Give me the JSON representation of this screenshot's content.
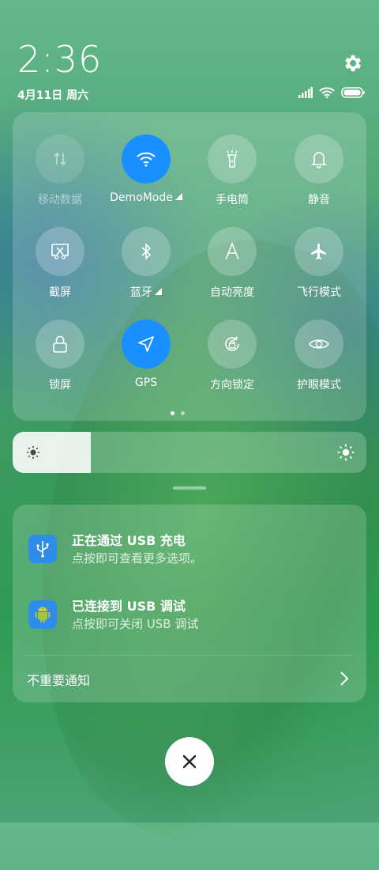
{
  "status_bar": {
    "time": "2:36",
    "date": "4月11日 周六",
    "icons": [
      "signal-icon",
      "wifi-icon",
      "battery-icon"
    ]
  },
  "quick_settings": {
    "tiles": [
      {
        "label": "移动数据",
        "icon": "mobile-data-icon",
        "state": "disabled"
      },
      {
        "label": "DemoMode",
        "icon": "wifi-icon",
        "state": "on",
        "has_submenu": true
      },
      {
        "label": "手电筒",
        "icon": "flashlight-icon",
        "state": "off"
      },
      {
        "label": "静音",
        "icon": "bell-icon",
        "state": "off"
      },
      {
        "label": "截屏",
        "icon": "screenshot-icon",
        "state": "off"
      },
      {
        "label": "蓝牙",
        "icon": "bluetooth-icon",
        "state": "off",
        "has_submenu": true
      },
      {
        "label": "自动亮度",
        "icon": "auto-brightness-icon",
        "state": "off"
      },
      {
        "label": "飞行模式",
        "icon": "airplane-icon",
        "state": "off"
      },
      {
        "label": "锁屏",
        "icon": "lock-icon",
        "state": "off"
      },
      {
        "label": "GPS",
        "icon": "location-icon",
        "state": "on"
      },
      {
        "label": "方向锁定",
        "icon": "rotation-lock-icon",
        "state": "off"
      },
      {
        "label": "护眼模式",
        "icon": "eye-icon",
        "state": "off"
      }
    ],
    "page_count": 2,
    "current_page": 1
  },
  "brightness": {
    "level": 0.22
  },
  "notifications": [
    {
      "title": "正在通过 USB 充电",
      "body": "点按即可查看更多选项。",
      "icon": "usb-icon"
    },
    {
      "title": "已连接到 USB 调试",
      "body": "点按即可关闭 USB 调试",
      "icon": "android-icon"
    }
  ],
  "unimportant": {
    "label": "不重要通知"
  },
  "colors": {
    "accent": "#1990ff",
    "notif_icon": "#2e8de8"
  }
}
